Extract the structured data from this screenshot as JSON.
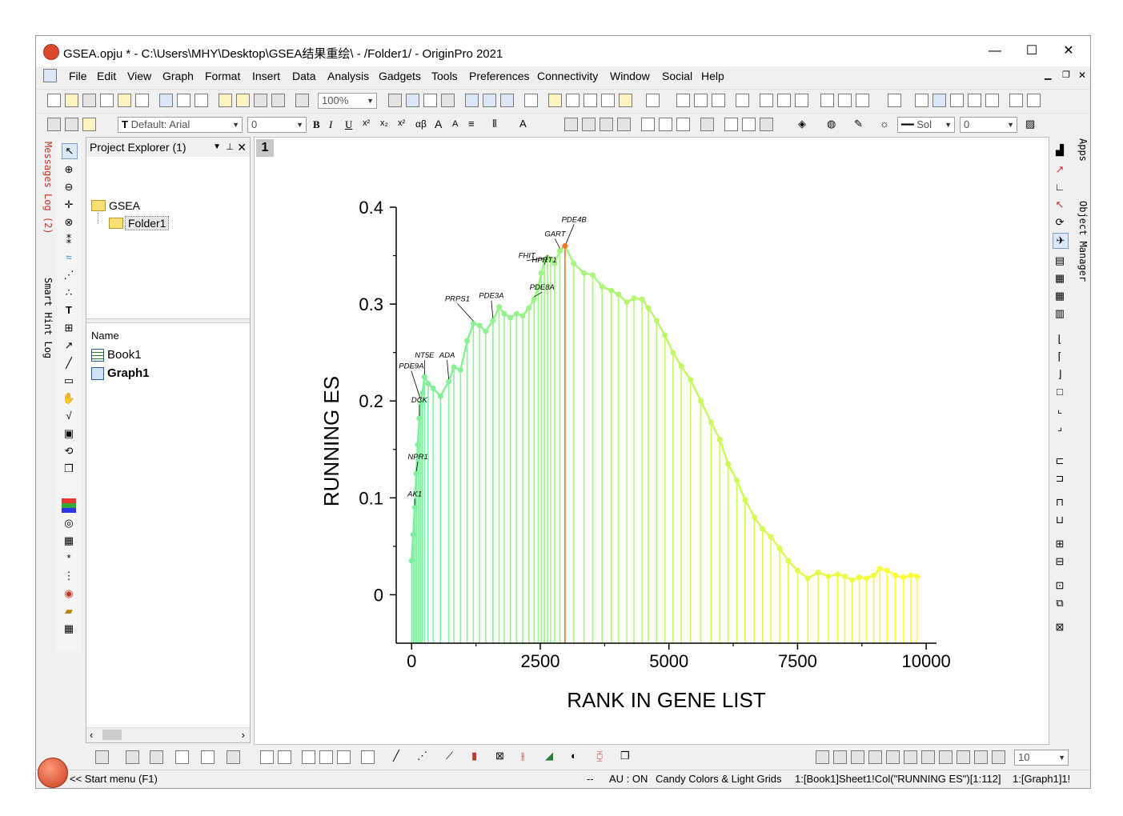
{
  "window": {
    "title": "GSEA.opju * - C:\\Users\\MHY\\Desktop\\GSEA结果重绘\\ - /Folder1/ - OriginPro 2021",
    "minimize": "—",
    "maximize": "☐",
    "close": "✕"
  },
  "menu": [
    "File",
    "Edit",
    "View",
    "Graph",
    "Format",
    "Insert",
    "Data",
    "Analysis",
    "Gadgets",
    "Tools",
    "Preferences",
    "Connectivity",
    "Window",
    "Social",
    "Help"
  ],
  "toolbar": {
    "zoom": "100%",
    "font": "Default: Arial",
    "font_size": "0",
    "line_style": "Sol",
    "line_width": "0",
    "bottom_size": "10"
  },
  "left_dock": {
    "messages_log": "Messages Log (2)",
    "smart_hint": "Smart Hint Log"
  },
  "right_dock": {
    "apps": "Apps",
    "object_manager": "Object Manager"
  },
  "project_explorer": {
    "title": "Project Explorer (1)",
    "root": "GSEA",
    "folder": "Folder1",
    "list_header": "Name",
    "items": [
      "Book1",
      "Graph1"
    ]
  },
  "graph": {
    "layer_tab": "1"
  },
  "status": {
    "start": "<< Start menu (F1)",
    "dash": "--",
    "au": "AU : ON",
    "theme": "Candy Colors & Light Grids",
    "column": "1:[Book1]Sheet1!Col(\"RUNNING ES\")[1:112]",
    "graph": "1:[Graph1]1!"
  },
  "colors": {
    "start": "#7cf0a0",
    "end": "#ffff33",
    "peak": "#f07820"
  },
  "chart_data": {
    "type": "line",
    "style": "line with drop lines, gradient colour",
    "xlabel": "RANK IN GENE LIST",
    "ylabel": "RUNNING ES",
    "xlim": [
      -300,
      10200
    ],
    "ylim": [
      -0.05,
      0.4
    ],
    "xticks": [
      0,
      2500,
      5000,
      7500,
      10000
    ],
    "yticks": [
      0,
      0.1,
      0.2,
      0.3,
      0.4
    ],
    "ytick_labels": [
      "0",
      "0.1",
      "0.2",
      "0.3",
      "0.4"
    ],
    "x": [
      0,
      30,
      60,
      90,
      120,
      150,
      180,
      210,
      250,
      320,
      420,
      560,
      720,
      820,
      950,
      1080,
      1200,
      1320,
      1440,
      1580,
      1700,
      1800,
      1920,
      2040,
      2160,
      2280,
      2380,
      2460,
      2520,
      2580,
      2640,
      2700,
      2780,
      2880,
      2980,
      3150,
      3350,
      3520,
      3700,
      3880,
      4020,
      4180,
      4320,
      4480,
      4600,
      4760,
      4920,
      5080,
      5240,
      5420,
      5620,
      5820,
      5990,
      6150,
      6320,
      6480,
      6660,
      6820,
      6980,
      7150,
      7320,
      7500,
      7700,
      7900,
      8100,
      8280,
      8420,
      8560,
      8700,
      8840,
      8980,
      9100,
      9240,
      9400,
      9560,
      9700,
      9820
    ],
    "y": [
      0.035,
      0.062,
      0.09,
      0.125,
      0.155,
      0.182,
      0.198,
      0.208,
      0.225,
      0.218,
      0.213,
      0.205,
      0.22,
      0.235,
      0.232,
      0.262,
      0.28,
      0.278,
      0.272,
      0.283,
      0.297,
      0.29,
      0.286,
      0.29,
      0.288,
      0.296,
      0.305,
      0.318,
      0.332,
      0.345,
      0.348,
      0.346,
      0.342,
      0.355,
      0.36,
      0.342,
      0.332,
      0.33,
      0.318,
      0.314,
      0.31,
      0.302,
      0.306,
      0.305,
      0.296,
      0.283,
      0.268,
      0.25,
      0.236,
      0.222,
      0.2,
      0.178,
      0.16,
      0.135,
      0.118,
      0.098,
      0.08,
      0.068,
      0.06,
      0.048,
      0.035,
      0.025,
      0.017,
      0.023,
      0.019,
      0.021,
      0.019,
      0.015,
      0.018,
      0.017,
      0.02,
      0.027,
      0.025,
      0.02,
      0.018,
      0.02,
      0.019
    ],
    "peak_index": 34,
    "annotations": [
      {
        "label": "PDE4B",
        "x": 3000,
        "y": 0.36
      },
      {
        "label": "GART",
        "x": 2880,
        "y": 0.355
      },
      {
        "label": "FHIT",
        "x": 2580,
        "y": 0.345
      },
      {
        "label": "HPRT1",
        "x": 2640,
        "y": 0.348
      },
      {
        "label": "PRPS1",
        "x": 1200,
        "y": 0.28
      },
      {
        "label": "PDE3A",
        "x": 1580,
        "y": 0.283
      },
      {
        "label": "PDE8A",
        "x": 2380,
        "y": 0.305
      },
      {
        "label": "PDE9A",
        "x": 180,
        "y": 0.198
      },
      {
        "label": "ADA",
        "x": 720,
        "y": 0.22
      },
      {
        "label": "NT5E",
        "x": 250,
        "y": 0.225
      },
      {
        "label": "DCK",
        "x": 150,
        "y": 0.182
      },
      {
        "label": "NPR1",
        "x": 90,
        "y": 0.125
      },
      {
        "label": "AK1",
        "x": 60,
        "y": 0.09
      }
    ]
  }
}
